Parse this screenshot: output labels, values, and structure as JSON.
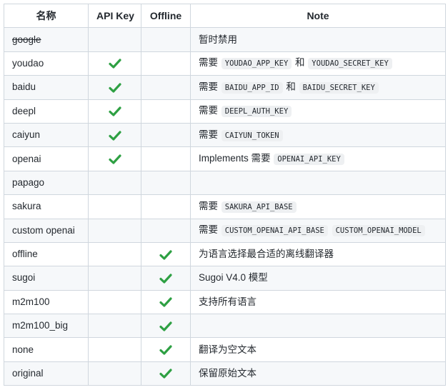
{
  "colors": {
    "border": "#d0d7de",
    "stripe": "#f6f8fa",
    "check": "#2ea043",
    "code_bg": "#eef0f2"
  },
  "table": {
    "headers": [
      "名称",
      "API Key",
      "Offline",
      "Note"
    ],
    "rows": [
      {
        "name": "google",
        "strikethrough": true,
        "api_key": false,
        "offline": false,
        "note": [
          {
            "text": "暂时禁用"
          }
        ]
      },
      {
        "name": "youdao",
        "api_key": true,
        "offline": false,
        "note": [
          {
            "text": "需要 "
          },
          {
            "code": "YOUDAO_APP_KEY"
          },
          {
            "text": " 和 "
          },
          {
            "code": "YOUDAO_SECRET_KEY"
          }
        ]
      },
      {
        "name": "baidu",
        "api_key": true,
        "offline": false,
        "note": [
          {
            "text": "需要 "
          },
          {
            "code": "BAIDU_APP_ID"
          },
          {
            "text": " 和 "
          },
          {
            "code": "BAIDU_SECRET_KEY"
          }
        ]
      },
      {
        "name": "deepl",
        "api_key": true,
        "offline": false,
        "note": [
          {
            "text": "需要 "
          },
          {
            "code": "DEEPL_AUTH_KEY"
          }
        ]
      },
      {
        "name": "caiyun",
        "api_key": true,
        "offline": false,
        "note": [
          {
            "text": "需要 "
          },
          {
            "code": "CAIYUN_TOKEN"
          }
        ]
      },
      {
        "name": "openai",
        "api_key": true,
        "offline": false,
        "note": [
          {
            "text": "Implements 需要 "
          },
          {
            "code": "OPENAI_API_KEY"
          }
        ]
      },
      {
        "name": "papago",
        "api_key": false,
        "offline": false,
        "note": []
      },
      {
        "name": "sakura",
        "api_key": false,
        "offline": false,
        "note": [
          {
            "text": "需要 "
          },
          {
            "code": "SAKURA_API_BASE"
          }
        ]
      },
      {
        "name": "custom openai",
        "api_key": false,
        "offline": false,
        "note": [
          {
            "text": "需要 "
          },
          {
            "code": "CUSTOM_OPENAI_API_BASE"
          },
          {
            "text": " "
          },
          {
            "code": "CUSTOM_OPENAI_MODEL"
          }
        ]
      },
      {
        "name": "offline",
        "api_key": false,
        "offline": true,
        "note": [
          {
            "text": "为语言选择最合适的离线翻译器"
          }
        ]
      },
      {
        "name": "sugoi",
        "api_key": false,
        "offline": true,
        "note": [
          {
            "text": "Sugoi V4.0 模型"
          }
        ]
      },
      {
        "name": "m2m100",
        "api_key": false,
        "offline": true,
        "note": [
          {
            "text": "支持所有语言"
          }
        ]
      },
      {
        "name": "m2m100_big",
        "api_key": false,
        "offline": true,
        "note": []
      },
      {
        "name": "none",
        "api_key": false,
        "offline": true,
        "note": [
          {
            "text": "翻译为空文本"
          }
        ]
      },
      {
        "name": "original",
        "api_key": false,
        "offline": true,
        "note": [
          {
            "text": "保留原始文本"
          }
        ]
      }
    ]
  }
}
